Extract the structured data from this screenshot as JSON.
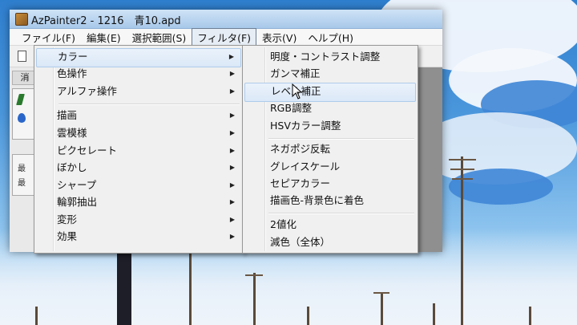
{
  "window": {
    "title": "AzPainter2 - 1216　青10.apd"
  },
  "menubar": {
    "items": [
      "ファイル(F)",
      "編集(E)",
      "選択範囲(S)",
      "フィルタ(F)",
      "表示(V)",
      "ヘルプ(H)"
    ],
    "active_index": 3
  },
  "left_panel": {
    "tab_label": "消",
    "label_a": "最",
    "label_b": "最"
  },
  "filter_menu": {
    "items": [
      "カラー",
      "色操作",
      "アルファ操作",
      "描画",
      "雲模様",
      "ピクセレート",
      "ぼかし",
      "シャープ",
      "輪郭抽出",
      "変形",
      "効果"
    ],
    "submenu_arrow": "▶",
    "highlighted_index": 0
  },
  "color_submenu": {
    "group1": [
      "明度・コントラスト調整",
      "ガンマ補正",
      "レベル補正",
      "RGB調整",
      "HSVカラー調整"
    ],
    "group2": [
      "ネガポジ反転",
      "グレイスケール",
      "セピアカラー",
      "描画色-背景色に着色"
    ],
    "group3": [
      "2値化",
      "減色（全体）"
    ],
    "hovered_item": "レベル補正"
  },
  "colors": {
    "menu_bg": "#f0f0f0",
    "highlight_bg": "#dbe8f7",
    "highlight_border": "#aecbea",
    "titlebar": "#a8c8ea"
  },
  "icons": {
    "app": "azpainter-app-icon",
    "new_doc": "document-icon",
    "cursor": "mouse-pointer-icon"
  }
}
